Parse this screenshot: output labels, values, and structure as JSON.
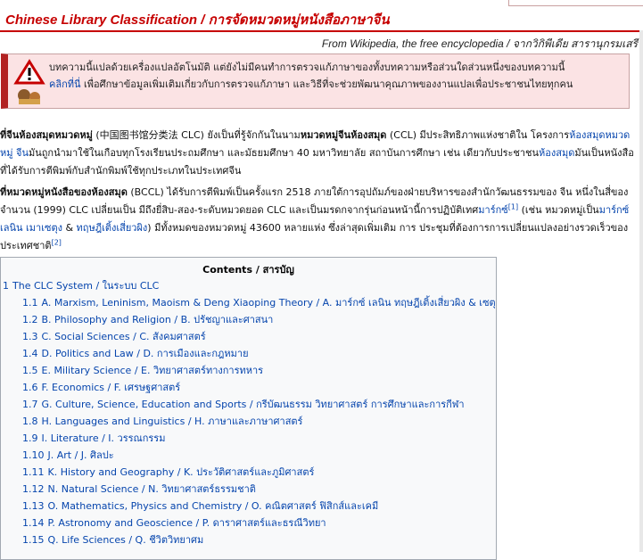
{
  "header": {
    "title": "Chinese Library Classification / การจัดหมวดหมู่หนังสือภาษาจีน",
    "from_wiki": "From Wikipedia, the free encyclopedia / จากวิกิพีเดีย สารานุกรมเสรี"
  },
  "notice": {
    "line1": "บทความนี้แปลด้วยเครื่องแปลอัตโนมัติ แต่ยังไม่มีคนทำการตรวจแก้ภาษาของทั้งบทความหรือส่วนใดส่วนหนึ่งของบทความนี้",
    "link1": "คลิกที่นี่",
    "line2_rest": " เพื่อศึกษาข้อมูลเพิ่มเติมเกี่ยวกับการตรวจแก้ภาษา และวิธีที่จะช่วยพัฒนาคุณภาพของงานแปลเพื่อประชาชนไทยทุกคน"
  },
  "intro": {
    "p1_a": "ที่จีนห้องสมุดหมวดหมู่",
    "p1_b": " (中国图书馆分类法 CLC) ยังเป็นที่รู้จักกันในนาม",
    "p1_c": "หมวดหมู่จีนห้องสมุด",
    "p1_d": " (CCL) มีประสิทธิภาพแห่งชาติใน โครงการ",
    "p1_link1": "ห้องสมุดหมวดหมู่",
    "p1_e": " ",
    "p1_link2": "จีน",
    "p1_f": "มันถูกนำมาใช้ในเกือบทุกโรงเรียนประถมศึกษา และมัธยมศึกษา 40 มหาวิทยาลัย สถาบันการศึกษา เช่น เดียวกับประชาชน",
    "p1_link3": "ห้องสมุด",
    "p1_g": "มันเป็นหนังสือที่ได้รับการตีพิมพ์กับสำนักพิมพ์ใช้ทุกประเภทในประเทศจีน",
    "p2_a": "ที่หมวดหมู่หนังสือของห้องสมุด",
    "p2_b": " (BCCL) ได้รับการตีพิมพ์เป็นครั้งแรก 2518 ภายใต้การอุปถัมภ์ของฝ่ายบริหารของสำนักวัฒนธรรมของ จีน หนึ่งในสี่ของจำนวน (1999) CLC เปลี่ยนเป็น มีถึงยี่สิบ-สอง-ระดับหมวดยอด CLC และเป็นมรดกจากรุ่นก่อนหน้านี้การปฏิบัติเทศ",
    "p2_link1": "มาร์กซ์",
    "p2_ref1": "[1]",
    "p2_c": " (เช่น หมวดหมู่เป็น",
    "p2_link2": "มาร์กซ์ เลนิน เมาเซตุง",
    "p2_d": " & ",
    "p2_link3": "ทฤษฎีเติ้งเสี่ยวผิง",
    "p2_e": ") มีทั้งหมดของหมวดหมู่ 43600 หลายแห่ง ซึ่งล่าสุดเพิ่มเติม การ ประชุมที่ต้องการการเปลี่ยนแปลงอย่างรวดเร็วของประเทศชาติ",
    "p2_ref2": "[2]"
  },
  "toc": {
    "title": "Contents / สารบัญ",
    "items": [
      {
        "num": "1",
        "label": "The CLC System / ในระบบ CLC",
        "level": 1
      },
      {
        "num": "1.1",
        "label": "A. Marxism, Leninism, Maoism & Deng Xiaoping Theory / A. มาร์กซ์ เลนิน ทฤษฎีเติ้งเสี่ยวผิง & เซตุง",
        "level": 2
      },
      {
        "num": "1.2",
        "label": "B. Philosophy and Religion / B. ปรัชญาและศาสนา",
        "level": 2
      },
      {
        "num": "1.3",
        "label": "C. Social Sciences / C. สังคมศาสตร์",
        "level": 2
      },
      {
        "num": "1.4",
        "label": "D. Politics and Law / D. การเมืองและกฎหมาย",
        "level": 2
      },
      {
        "num": "1.5",
        "label": "E. Military Science / E. วิทยาศาสตร์ทางการทหาร",
        "level": 2
      },
      {
        "num": "1.6",
        "label": "F. Economics / F. เศรษฐศาสตร์",
        "level": 2
      },
      {
        "num": "1.7",
        "label": "G. Culture, Science, Education and Sports / กรีบัฒนธรรม วิทยาศาสตร์ การศึกษาและการกีฬา",
        "level": 2
      },
      {
        "num": "1.8",
        "label": "H. Languages and Linguistics / H. ภาษาและภาษาศาสตร์",
        "level": 2
      },
      {
        "num": "1.9",
        "label": "I. Literature / I. วรรณกรรม",
        "level": 2
      },
      {
        "num": "1.10",
        "label": "J. Art / J. ศิลปะ",
        "level": 2
      },
      {
        "num": "1.11",
        "label": "K. History and Geography / K. ประวัติศาสตร์และภูมิศาสตร์",
        "level": 2
      },
      {
        "num": "1.12",
        "label": "N. Natural Science / N. วิทยาศาสตร์ธรรมชาติ",
        "level": 2
      },
      {
        "num": "1.13",
        "label": "O. Mathematics, Physics and Chemistry / O. คณิตศาสตร์ ฟิสิกส์และเคมี",
        "level": 2
      },
      {
        "num": "1.14",
        "label": "P. Astronomy and Geoscience / P. ดาราศาสตร์และธรณีวิทยา",
        "level": 2
      },
      {
        "num": "1.15",
        "label": "Q. Life Sciences / Q. ชีวิตวิทยาศม",
        "level": 2
      }
    ]
  },
  "colors": {
    "accent": "#c60000",
    "link": "#0645ad",
    "notice_bg": "#fbe3e4"
  },
  "icons": {
    "warning": "warning-triangle-icon",
    "tools": "tools-icon"
  }
}
